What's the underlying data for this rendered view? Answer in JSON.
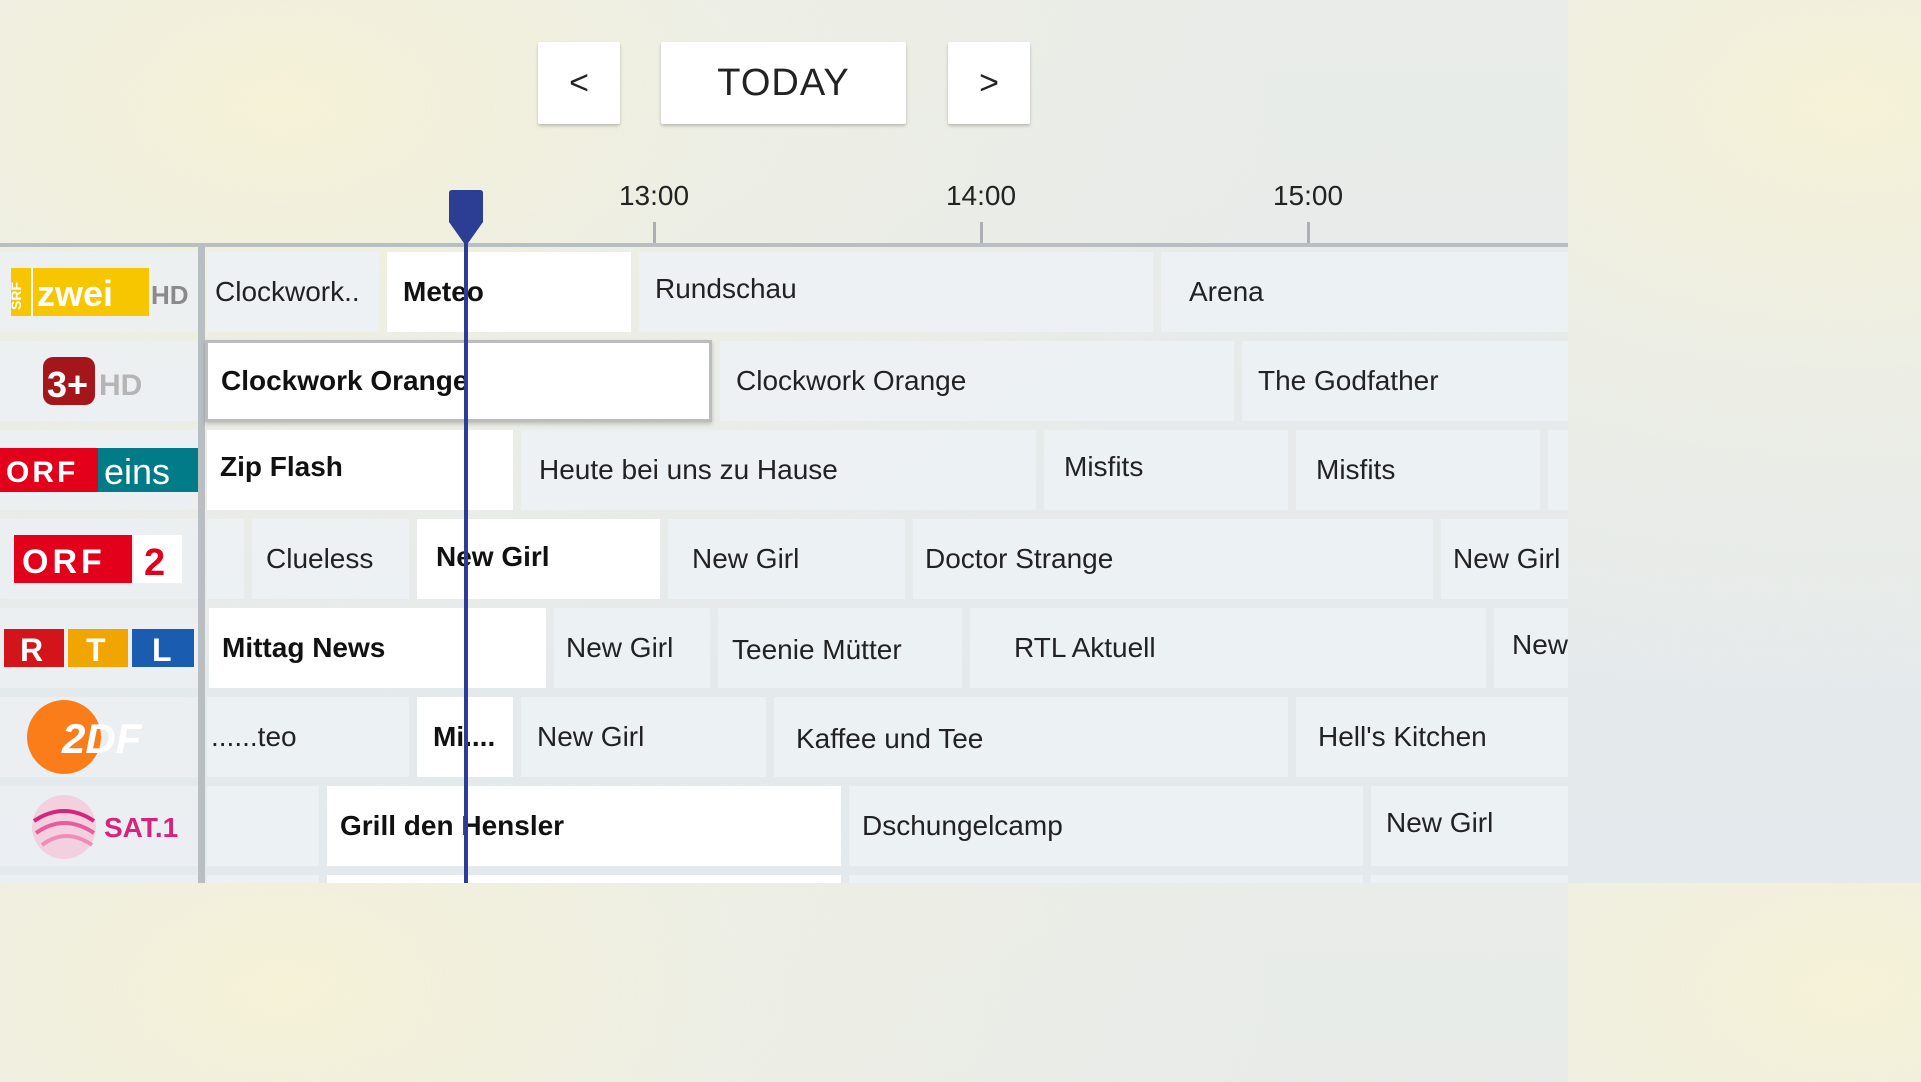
{
  "nav": {
    "prev_label": "<",
    "today_label": "TODAY",
    "next_label": ">"
  },
  "timeline": {
    "labels": [
      "13:00",
      "14:00",
      "15:00"
    ]
  },
  "channels": [
    {
      "name": "SRF zwei HD",
      "logo_text": "zwei",
      "logo_sub": "SRF",
      "logo_hd": "HD",
      "programs": [
        "Clockwork..",
        "Meteo",
        "Rundschau",
        "Arena"
      ]
    },
    {
      "name": "3+ HD",
      "logo_text": "3+",
      "logo_hd": "HD",
      "programs": [
        "Clockwork Orange",
        "Clockwork Orange",
        "The Godfather"
      ]
    },
    {
      "name": "ORF eins",
      "logo_text": "ORF",
      "logo_sub": "eins",
      "programs": [
        "Zip Flash",
        "Heute bei uns zu Hause",
        "Misfits",
        "Misfits"
      ]
    },
    {
      "name": "ORF 2",
      "logo_text": "ORF",
      "logo_sub": "2",
      "programs": [
        "",
        "Clueless",
        "New Girl",
        "New Girl",
        "Doctor Strange",
        "New Girl"
      ]
    },
    {
      "name": "RTL",
      "logo_letters": [
        "R",
        "T",
        "L"
      ],
      "programs": [
        "Mittag News",
        "New Girl",
        "Teenie Mütter",
        "RTL Aktuell",
        "New"
      ]
    },
    {
      "name": "ZDF",
      "logo_text": "2DF",
      "programs": [
        "......teo",
        "Mi....",
        "New Girl",
        "Kaffee und Tee",
        "Hell's Kitchen"
      ]
    },
    {
      "name": "SAT.1",
      "logo_text": "SAT.1",
      "programs": [
        "",
        "Grill den Hensler",
        "Dschungelcamp",
        "New Girl"
      ]
    }
  ],
  "colors": {
    "now_indicator": "#2c3e94",
    "srf_yellow": "#f7c600",
    "orf_red": "#e2001a",
    "orf_teal": "#007b87",
    "zdf_orange": "#fa7d19",
    "sat1_pink": "#d6247a"
  }
}
